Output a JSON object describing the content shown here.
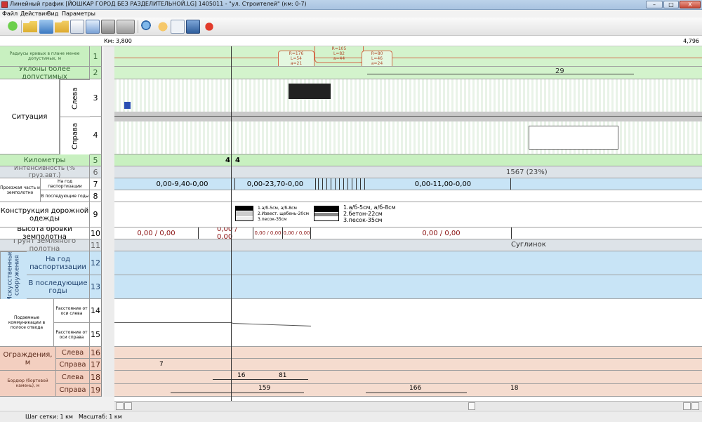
{
  "window": {
    "title": "Линейный график [ЙОШКАР ГОРОД БЕЗ РАЗДЕЛИТЕЛЬНОЙ.LG] 1405011 - \"ул. Строителей\" (км: 0-7)",
    "minimize": "–",
    "maximize": "□",
    "close": "X"
  },
  "menu": [
    "Файл",
    "Действия",
    "Вид",
    "Параметры"
  ],
  "toolbar": {
    "icons": [
      "go-green-icon",
      "folder-open-icon",
      "save-icon",
      "folder-icon",
      "report-icon",
      "print-preview-icon",
      "print-icon",
      "camera-icon",
      "search-icon",
      "hand-icon",
      "blank-icon",
      "settings-icon",
      "bug-icon"
    ]
  },
  "km_strip": {
    "start": "Км: 3,800",
    "end": "4,796"
  },
  "rows": [
    {
      "n": "1",
      "label": "Радиусы кривых в плане менее допустимых, м"
    },
    {
      "n": "2",
      "label": "Уклоны более допустимых"
    },
    {
      "n": "3",
      "label": "Слева"
    },
    {
      "n": "4",
      "label": "Справа"
    },
    {
      "n": "5",
      "label": "Километры"
    },
    {
      "n": "6",
      "label": "Интенсивность (% груз.авт.)"
    },
    {
      "n": "7",
      "label": "На год паспортизации"
    },
    {
      "n": "8",
      "label": "В последующие годы"
    },
    {
      "n": "9",
      "label": "Конструкция дорожной одежды"
    },
    {
      "n": "10",
      "label": "Высота бровки земполотна"
    },
    {
      "n": "11",
      "label": "Грунт земляного полотна"
    },
    {
      "n": "12",
      "label": "На год паспортизации"
    },
    {
      "n": "13",
      "label": "В последующие годы"
    },
    {
      "n": "14",
      "label": "Расстояние от оси слева"
    },
    {
      "n": "15",
      "label": "Расстояние от оси справа"
    },
    {
      "n": "16",
      "label": "Слева"
    },
    {
      "n": "17",
      "label": "Справа"
    },
    {
      "n": "18",
      "label": "Слева"
    },
    {
      "n": "19",
      "label": "Справа"
    }
  ],
  "group_labels": {
    "situation": "Ситуация",
    "roadway": "Проезжая часть и земполотно",
    "structures": "Искусственные сооружения",
    "utilities": "Подземные коммуникации в полосе отвода",
    "fences": "Ограждения, м",
    "curbs": "Бордюр (бортовой камень), м"
  },
  "curves": [
    {
      "r": "R=176",
      "l": "L=54",
      "a": "a=21"
    },
    {
      "r": "R=105",
      "l": "L=82",
      "a": "a=44"
    },
    {
      "r": "R=80",
      "l": "L=46",
      "a": "a=24"
    }
  ],
  "slope_value": "29",
  "km_marks": [
    "4",
    "4"
  ],
  "intensity": "1567 (23%)",
  "roadway_segments": [
    "0,00-9,40-0,00",
    "0,00-23,70-0,00",
    "0,00-11,00-0,00"
  ],
  "pavement": {
    "a": [
      "1.а/б-5см, а/б-8см",
      "2.Извест. щебень-20см",
      "3.песок-35см"
    ],
    "b": [
      "1.а/б-5см, а/б-8см",
      "2.бетон-22см",
      "3.песок-35см"
    ]
  },
  "embankment": [
    "0,00 / 0,00",
    "0,00 / 0,00",
    "0,00 / 0,00",
    "0,00 / 0,00",
    "0,00 / 0,00"
  ],
  "soil": "Суглинок",
  "fence_values": [
    "7"
  ],
  "curb_left": [
    "16",
    "81"
  ],
  "curb_right": [
    "159",
    "166",
    "18"
  ],
  "status": {
    "grid": "Шаг сетки: 1 км",
    "scale": "Масштаб: 1 км"
  }
}
